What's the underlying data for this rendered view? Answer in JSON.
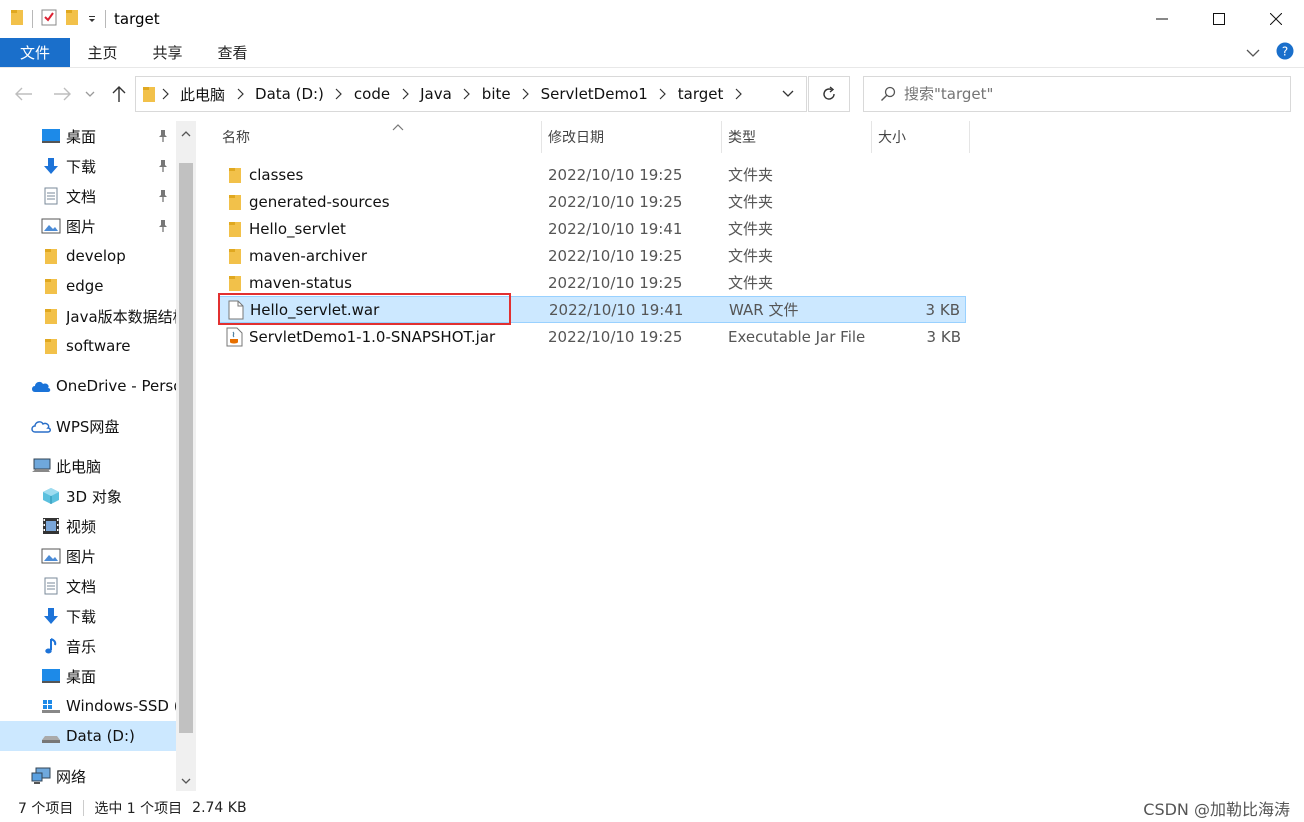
{
  "window": {
    "title": "target",
    "colors": {
      "accent": "#1a6fcb",
      "selection": "#cce8ff",
      "highlight": "#e23030",
      "folder": "#f2c14a"
    }
  },
  "ribbon": {
    "tabs": [
      {
        "label": "文件",
        "active": true
      },
      {
        "label": "主页"
      },
      {
        "label": "共享"
      },
      {
        "label": "查看"
      }
    ]
  },
  "address": {
    "crumbs": [
      "此电脑",
      "Data (D:)",
      "code",
      "Java",
      "bite",
      "ServletDemo1",
      "target"
    ]
  },
  "search": {
    "placeholder": "搜索\"target\""
  },
  "sidebar": {
    "items": [
      {
        "label": "桌面",
        "icon": "desktop-icon",
        "pinned": true
      },
      {
        "label": "下载",
        "icon": "download-icon",
        "pinned": true
      },
      {
        "label": "文档",
        "icon": "document-icon",
        "pinned": true
      },
      {
        "label": "图片",
        "icon": "picture-icon",
        "pinned": true
      },
      {
        "label": "develop",
        "icon": "folder-icon"
      },
      {
        "label": "edge",
        "icon": "folder-icon"
      },
      {
        "label": "Java版本数据结构",
        "icon": "folder-icon"
      },
      {
        "label": "software",
        "icon": "folder-icon"
      },
      {
        "label": "OneDrive - Personal",
        "icon": "onedrive-icon"
      },
      {
        "label": "WPS网盘",
        "icon": "wps-cloud-icon"
      },
      {
        "label": "此电脑",
        "icon": "this-pc-icon"
      },
      {
        "label": "3D 对象",
        "icon": "3d-objects-icon"
      },
      {
        "label": "视频",
        "icon": "video-icon"
      },
      {
        "label": "图片",
        "icon": "picture-icon"
      },
      {
        "label": "文档",
        "icon": "document-icon"
      },
      {
        "label": "下载",
        "icon": "download-icon"
      },
      {
        "label": "音乐",
        "icon": "music-icon"
      },
      {
        "label": "桌面",
        "icon": "desktop-icon"
      },
      {
        "label": "Windows-SSD (C:)",
        "icon": "drive-icon"
      },
      {
        "label": "Data (D:)",
        "icon": "drive-icon",
        "selected": true
      },
      {
        "label": "网络",
        "icon": "network-icon"
      }
    ]
  },
  "columns": {
    "name": "名称",
    "date": "修改日期",
    "type": "类型",
    "size": "大小"
  },
  "files": [
    {
      "name": "classes",
      "date": "2022/10/10 19:25",
      "type": "文件夹",
      "size": "",
      "icon": "folder-icon"
    },
    {
      "name": "generated-sources",
      "date": "2022/10/10 19:25",
      "type": "文件夹",
      "size": "",
      "icon": "folder-icon"
    },
    {
      "name": "Hello_servlet",
      "date": "2022/10/10 19:41",
      "type": "文件夹",
      "size": "",
      "icon": "folder-icon"
    },
    {
      "name": "maven-archiver",
      "date": "2022/10/10 19:25",
      "type": "文件夹",
      "size": "",
      "icon": "folder-icon"
    },
    {
      "name": "maven-status",
      "date": "2022/10/10 19:25",
      "type": "文件夹",
      "size": "",
      "icon": "folder-icon"
    },
    {
      "name": "Hello_servlet.war",
      "date": "2022/10/10 19:41",
      "type": "WAR 文件",
      "size": "3 KB",
      "icon": "file-icon",
      "selected": true
    },
    {
      "name": "ServletDemo1-1.0-SNAPSHOT.jar",
      "date": "2022/10/10 19:25",
      "type": "Executable Jar File",
      "size": "3 KB",
      "icon": "jar-icon"
    }
  ],
  "status": {
    "count": "7 个项目",
    "selected": "选中 1 个项目",
    "size": "2.74 KB"
  },
  "watermark": "CSDN @加勒比海涛"
}
